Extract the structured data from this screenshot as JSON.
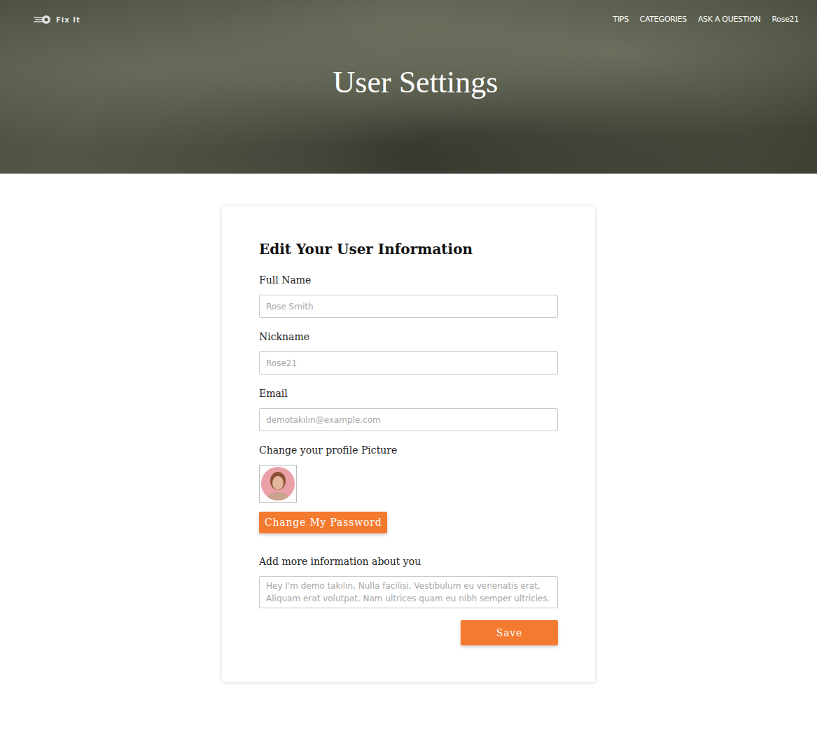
{
  "logo": {
    "text": "Fix It"
  },
  "nav": {
    "items": [
      {
        "label": "TIPS"
      },
      {
        "label": "CATEGORIES"
      },
      {
        "label": "ASK A QUESTION"
      },
      {
        "label": "Rose21"
      }
    ]
  },
  "header": {
    "title": "User Settings"
  },
  "form": {
    "heading": "Edit Your User Information",
    "fields": [
      {
        "label": "Full Name",
        "placeholder": "Rose Smith"
      },
      {
        "label": "Nickname",
        "placeholder": "Rose21"
      },
      {
        "label": "Email",
        "placeholder": "demotakılın@example.com"
      }
    ],
    "picture": {
      "label": "Change your profile Picture"
    },
    "password_button": "Change My Password",
    "about": {
      "label": "Add more information about you",
      "placeholder": "Hey I'm demo takılın, Nulla facilisi. Vestibulum eu venenatis erat. Aliquam erat volutpat. Nam ultrices quam eu nibh semper ultricies."
    },
    "save_button": "Save"
  }
}
